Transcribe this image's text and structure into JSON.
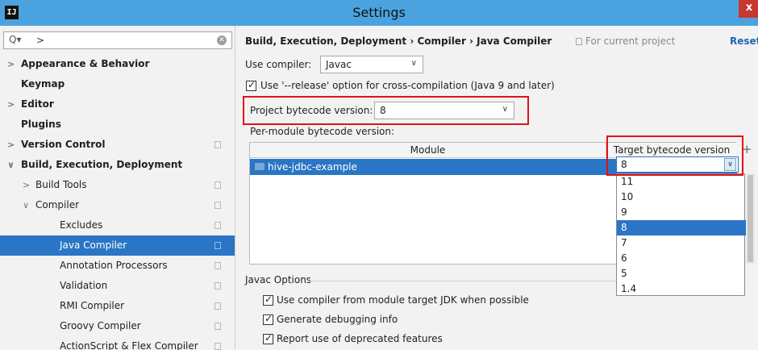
{
  "window": {
    "title": "Settings",
    "app_icon": "IJ",
    "close_label": "x"
  },
  "search": {
    "icon": "Q▾",
    "value": ">"
  },
  "sidebar": {
    "items": [
      {
        "label": "Appearance & Behavior",
        "arrow": ">"
      },
      {
        "label": "Keymap",
        "arrow": ""
      },
      {
        "label": "Editor",
        "arrow": ">"
      },
      {
        "label": "Plugins",
        "arrow": ""
      },
      {
        "label": "Version Control",
        "arrow": ">"
      },
      {
        "label": "Build, Execution, Deployment",
        "arrow": "∨"
      },
      {
        "label": "Build Tools",
        "arrow": ">"
      },
      {
        "label": "Compiler",
        "arrow": "∨"
      },
      {
        "label": "Excludes",
        "arrow": ""
      },
      {
        "label": "Java Compiler",
        "arrow": ""
      },
      {
        "label": "Annotation Processors",
        "arrow": ""
      },
      {
        "label": "Validation",
        "arrow": ""
      },
      {
        "label": "RMI Compiler",
        "arrow": ""
      },
      {
        "label": "Groovy Compiler",
        "arrow": ""
      },
      {
        "label": "ActionScript & Flex Compiler",
        "arrow": ""
      }
    ]
  },
  "header": {
    "breadcrumb": "Build, Execution, Deployment  ›  Compiler  ›  Java Compiler",
    "for_current_project": "For current project",
    "reset": "Reset"
  },
  "compiler": {
    "use_compiler_label": "Use compiler:",
    "use_compiler_value": "Javac",
    "release_option_label": "Use '--release' option for cross-compilation (Java 9 and later)",
    "project_bytecode_label": "Project bytecode version:",
    "project_bytecode_value": "8",
    "per_module_label": "Per-module bytecode version:"
  },
  "table": {
    "headers": {
      "module": "Module",
      "target": "Target bytecode version"
    },
    "row": {
      "module": "hive-jdbc-example",
      "target": "8"
    },
    "add": "+"
  },
  "dropdown": {
    "options": [
      "11",
      "10",
      "9",
      "8",
      "7",
      "6",
      "5",
      "1.4"
    ],
    "selected": "8"
  },
  "javac_options": {
    "section_label": "Javac Options",
    "options": [
      "Use compiler from module target JDK when possible",
      "Generate debugging info",
      "Report use of deprecated features"
    ]
  },
  "colors": {
    "accent": "#2a75c5",
    "titlebar": "#4aa3df",
    "highlight": "#e0121b",
    "link": "#1e64b5"
  }
}
